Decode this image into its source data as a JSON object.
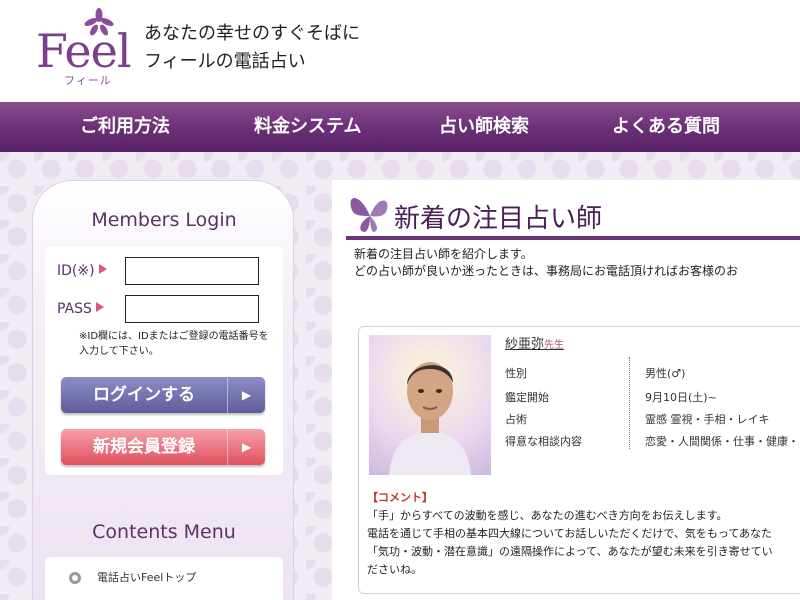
{
  "header": {
    "logo_text": "Feel",
    "logo_sub": "フィール",
    "tagline_line1": "あなたの幸せのすぐそばに",
    "tagline_line2": "フィールの電話占い"
  },
  "nav": {
    "items": [
      {
        "label": "ご利用方法"
      },
      {
        "label": "料金システム"
      },
      {
        "label": "占い師検索"
      },
      {
        "label": "よくある質問"
      }
    ]
  },
  "login": {
    "title": "Members Login",
    "id_label": "ID(※)",
    "pass_label": "PASS",
    "id_value": "",
    "pass_value": "",
    "note": "※ID欄には、IDまたはご登録の電話番号を入力して下さい。",
    "login_button": "ログインする",
    "register_button": "新規会員登録",
    "arrow": "▶"
  },
  "contents_menu": {
    "title": "Contents Menu",
    "items": [
      {
        "label": "電話占いFeelトップ"
      }
    ]
  },
  "main": {
    "section_title": "新着の注目占い師",
    "intro_line1": "新着の注目占い師を紹介します。",
    "intro_line2": "どの占い師が良いか迷ったときは、事務局にお電話頂ければお客様のお"
  },
  "fortune_teller": {
    "name": "紗亜弥",
    "honorific": "先生",
    "profile": [
      {
        "label": "性別",
        "value": "男性(♂)"
      },
      {
        "label": "鑑定開始",
        "value": "9月10日(土)~"
      },
      {
        "label": "占術",
        "value": "霊感 霊視・手相・レイキ"
      },
      {
        "label": "得意な相談内容",
        "value": "恋愛・人間関係・仕事・健康・"
      }
    ],
    "comment_title": "【コメント】",
    "comment_lines": [
      "「手」からすべての波動を感じ、あなたの進むべき方向をお伝えします。",
      "電話を通じて手相の基本四大線についてお話しいただくだけで、気をもってあなた",
      "「気功・波動・潜在意識」の遠隔操作によって、あなたが望む未来を引き寄せてい",
      "ださいね。"
    ]
  },
  "colors": {
    "brand_purple": "#6a2e76",
    "accent_pink": "#e0547c",
    "login_button": "#5f5e9c",
    "register_button": "#e0505e"
  },
  "icons": {
    "logo": "flower-icon",
    "title": "butterfly-icon",
    "bullet": "circle-bullet-icon"
  }
}
